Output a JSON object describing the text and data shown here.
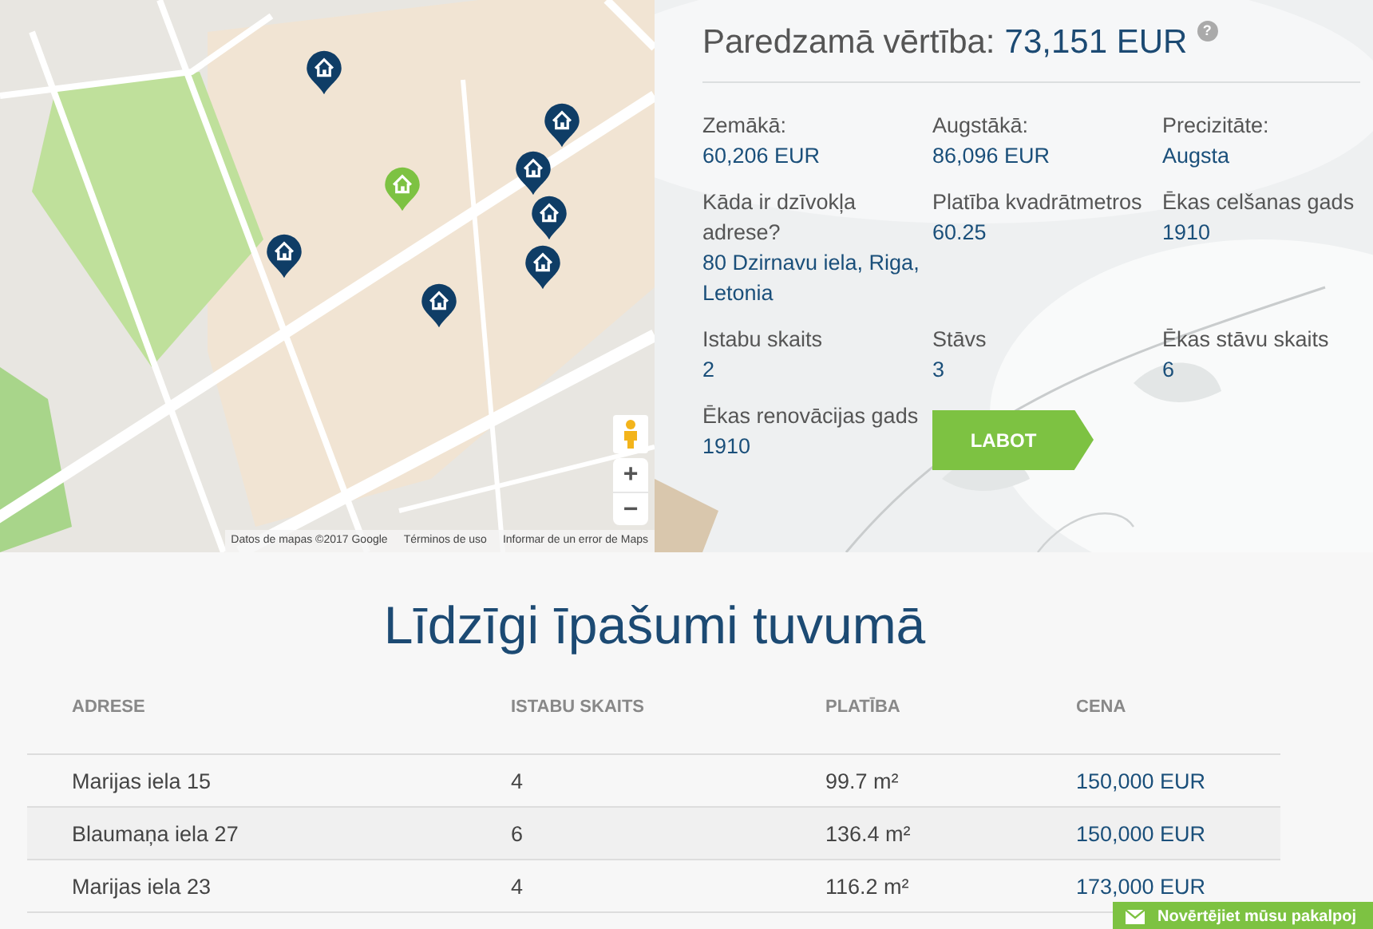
{
  "map": {
    "markers": [
      {
        "selected": false
      },
      {
        "selected": true
      },
      {
        "selected": false
      },
      {
        "selected": false
      },
      {
        "selected": false
      },
      {
        "selected": false
      },
      {
        "selected": false
      },
      {
        "selected": false
      }
    ],
    "zoom_in": "+",
    "zoom_out": "−",
    "attribution": [
      "Datos de mapas ©2017 Google",
      "Términos de uso",
      "Informar de un error de Maps"
    ]
  },
  "valuation": {
    "label": "Paredzamā vērtība:",
    "value": "73,151 EUR",
    "help": "?",
    "fields": [
      {
        "label": "Zemākā:",
        "value": "60,206 EUR"
      },
      {
        "label": "Augstākā:",
        "value": "86,096 EUR"
      },
      {
        "label": "Precizitāte:",
        "value": "Augsta"
      },
      {
        "label": "Kāda ir dzīvokļa adrese?",
        "value": "80 Dzirnavu iela, Riga, Letonia"
      },
      {
        "label": "Platība kvadrātmetros",
        "value": "60.25"
      },
      {
        "label": "Ēkas celšanas gads",
        "value": "1910"
      },
      {
        "label": "Istabu skaits",
        "value": "2"
      },
      {
        "label": "Stāvs",
        "value": "3"
      },
      {
        "label": "Ēkas stāvu skaits",
        "value": "6"
      },
      {
        "label": "Ēkas renovācijas gads",
        "value": "1910"
      }
    ],
    "edit_button": "LABOT"
  },
  "similar": {
    "title": "Līdzīgi īpašumi tuvumā",
    "columns": [
      "ADRESE",
      "ISTABU SKAITS",
      "PLATĪBA",
      "CENA"
    ],
    "rows": [
      [
        "Marijas iela 15",
        "4",
        "99.7 m²",
        "150,000 EUR"
      ],
      [
        "Blaumaņa iela 27",
        "6",
        "136.4 m²",
        "150,000 EUR"
      ],
      [
        "Marijas iela 23",
        "4",
        "116.2 m²",
        "173,000 EUR"
      ]
    ]
  },
  "feedback_tab": "Novērtējiet mūsu pakalpoj"
}
